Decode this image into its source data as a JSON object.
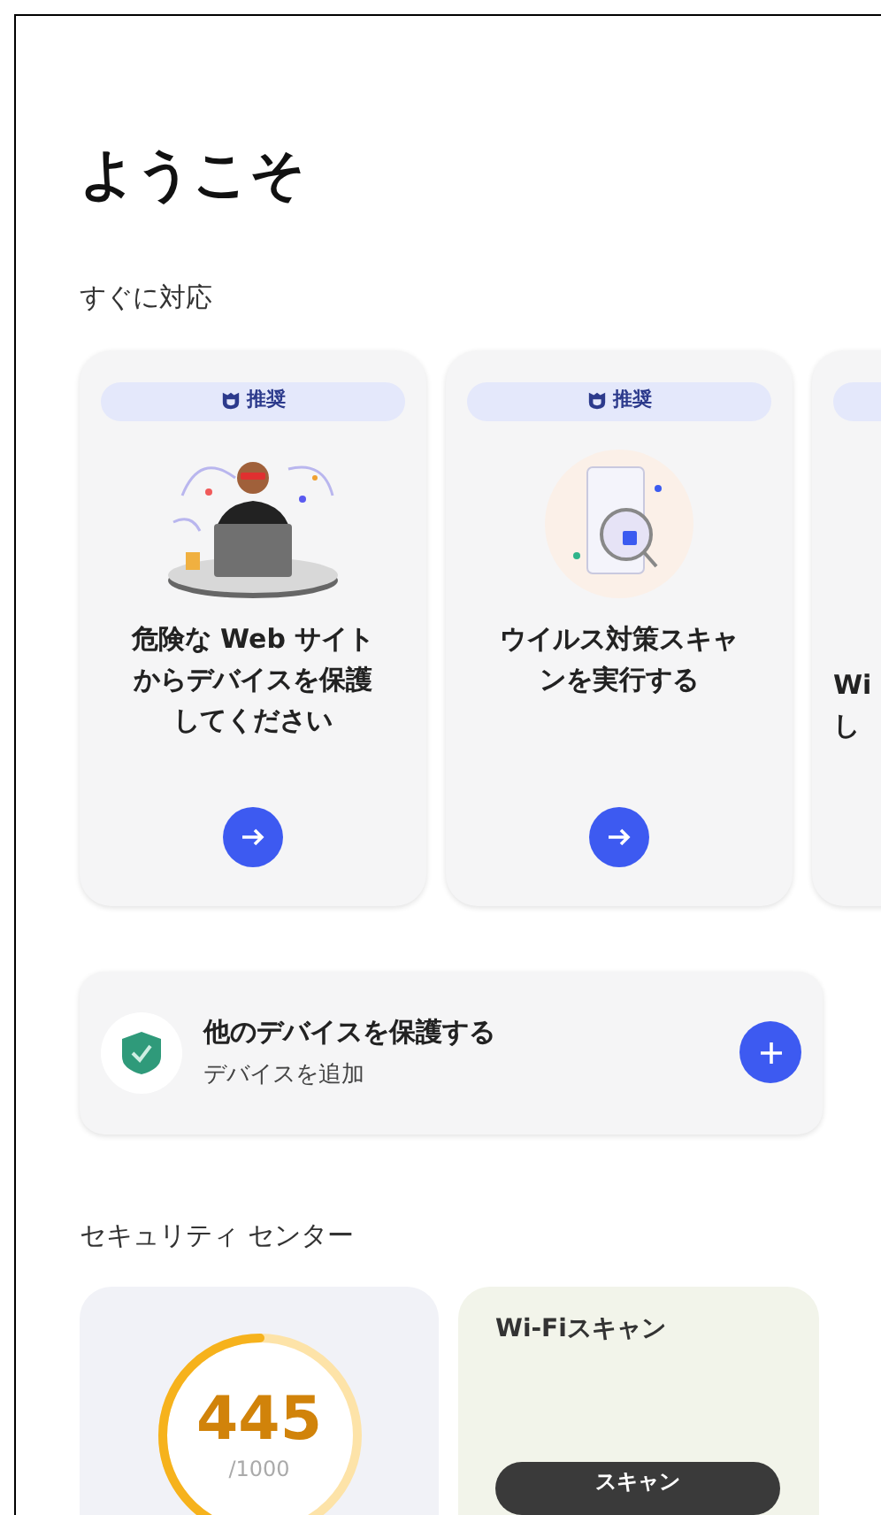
{
  "title": "ようこそ",
  "quick_actions": {
    "heading": "すぐに対応",
    "cards": [
      {
        "kind": "person",
        "badge": "推奨",
        "title": "危険な Web サイトからデバイスを保護してください"
      },
      {
        "kind": "scan",
        "badge": "推奨",
        "title": "ウイルス対策スキャンを実行する"
      },
      {
        "kind": "partial",
        "title_lines": [
          "Wi",
          "し"
        ]
      }
    ]
  },
  "device_card": {
    "title": "他のデバイスを保護する",
    "subtitle": "デバイスを追加"
  },
  "security_center": {
    "heading": "セキュリティ センター",
    "score": {
      "value": "445",
      "max": "/1000",
      "level": 0.445
    },
    "wifi": {
      "title": "Wi-Fiスキャン",
      "button": "スキャン"
    }
  }
}
